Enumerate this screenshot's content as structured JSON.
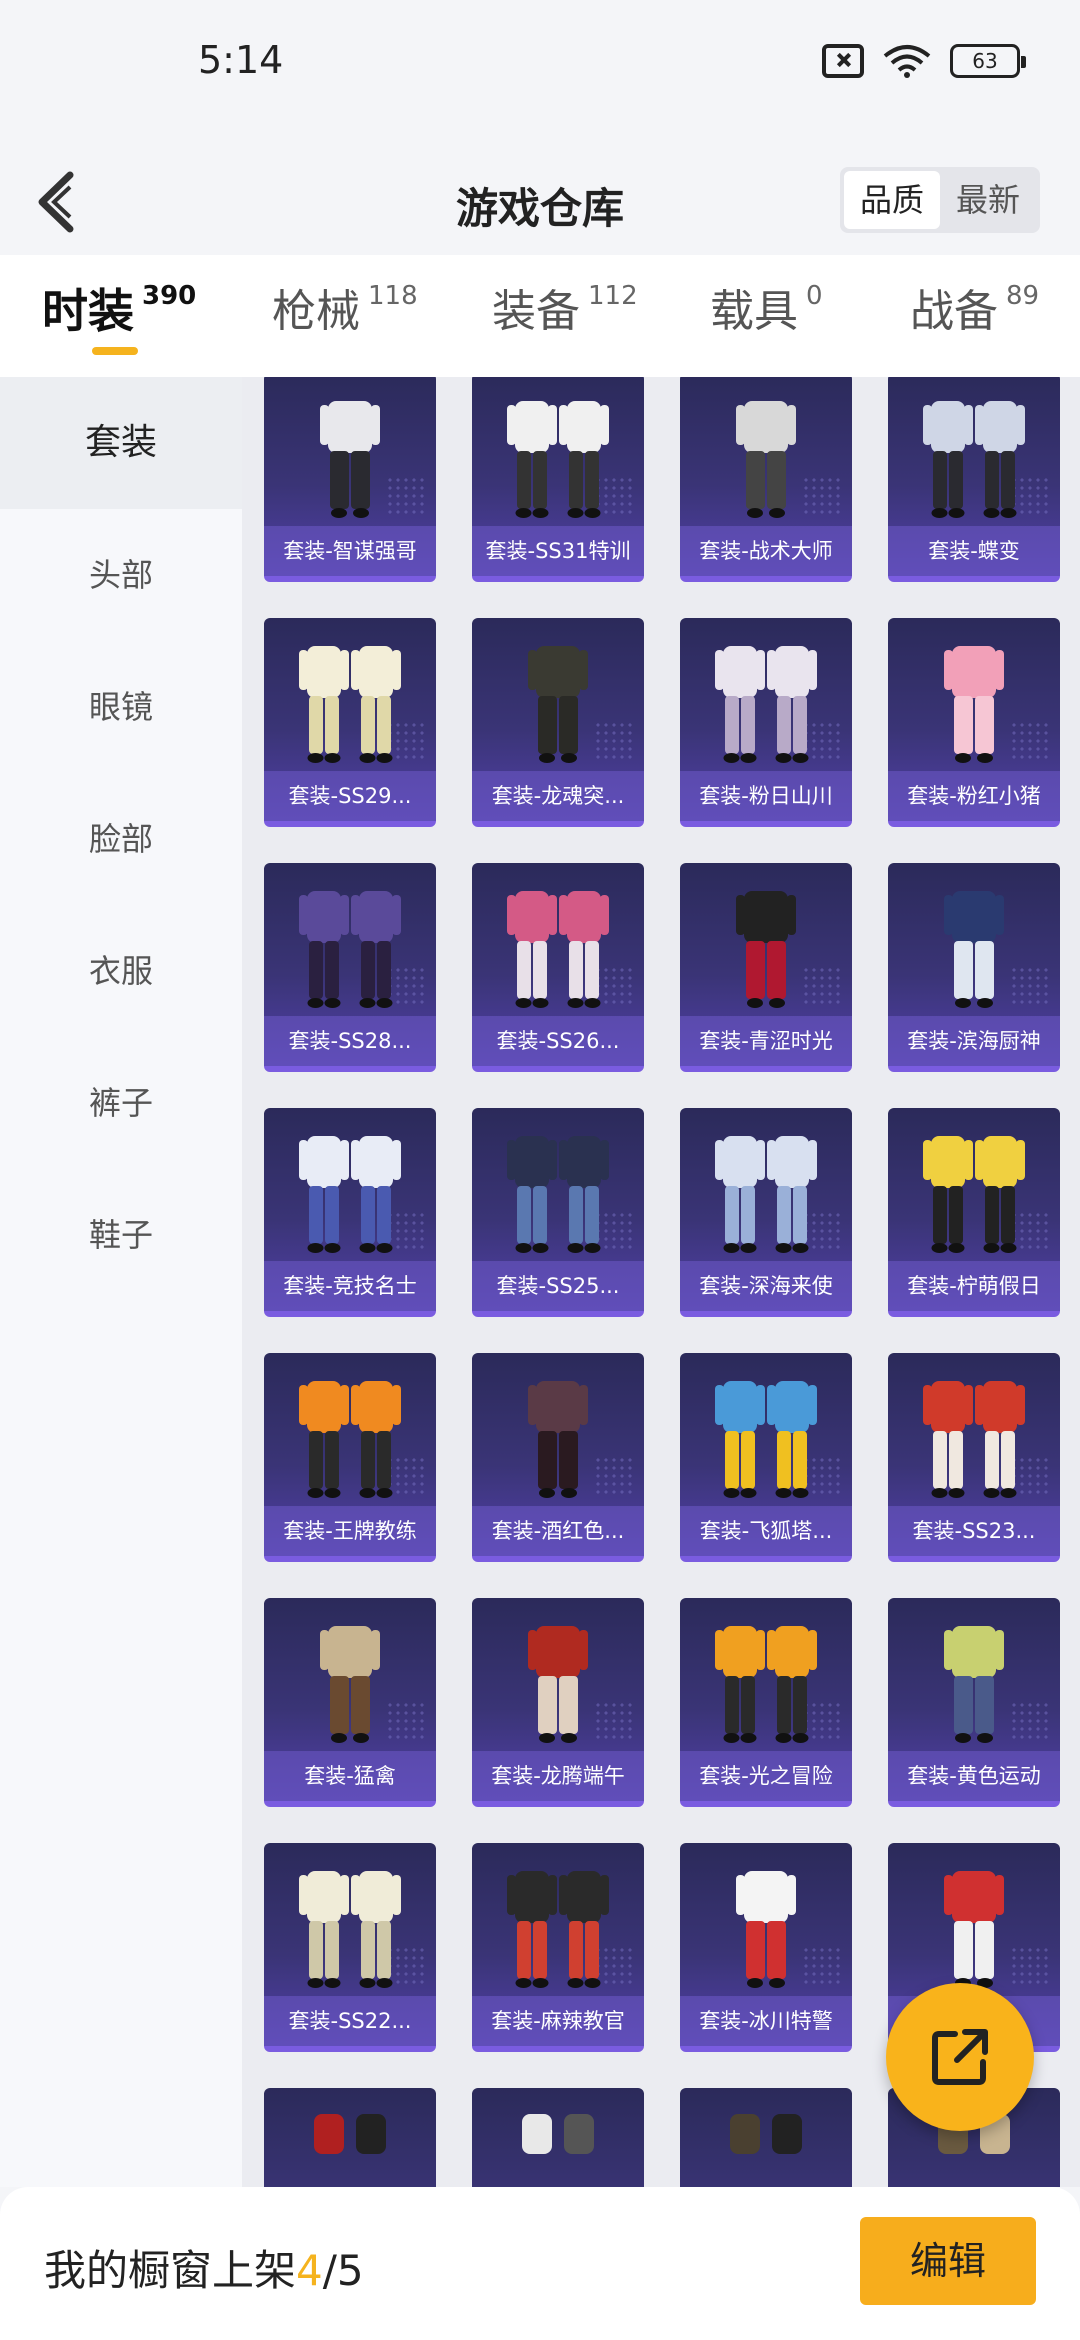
{
  "status_bar": {
    "time": "5:14",
    "battery": "63"
  },
  "header": {
    "title": "游戏仓库",
    "sort_options": [
      "品质",
      "最新"
    ]
  },
  "tabs": [
    {
      "label": "时装",
      "count": "390"
    },
    {
      "label": "枪械",
      "count": "118"
    },
    {
      "label": "装备",
      "count": "112"
    },
    {
      "label": "载具",
      "count": "0"
    },
    {
      "label": "战备",
      "count": "89"
    }
  ],
  "sidebar": [
    "套装",
    "头部",
    "眼镜",
    "脸部",
    "衣服",
    "裤子",
    "鞋子"
  ],
  "items": [
    "套装-智谋强哥",
    "套装-SS31特训",
    "套装-战术大师",
    "套装-蝶变",
    "套装-SS29...",
    "套装-龙魂突...",
    "套装-粉日山川",
    "套装-粉红小猪",
    "套装-SS28...",
    "套装-SS26...",
    "套装-青涩时光",
    "套装-滨海厨神",
    "套装-竞技名士",
    "套装-SS25...",
    "套装-深海来使",
    "套装-柠萌假日",
    "套装-王牌教练",
    "套装-酒红色...",
    "套装-飞狐塔...",
    "套装-SS23...",
    "套装-猛禽",
    "套装-龙腾端午",
    "套装-光之冒险",
    "套装-黄色运动",
    "套装-SS22...",
    "套装-麻辣教官",
    "套装-冰川特警",
    "套装-"
  ],
  "bottom_bar": {
    "label": "我的橱窗上架",
    "count_current": "4",
    "count_sep": "/",
    "count_total": "5",
    "edit_label": "编辑"
  },
  "colors": {
    "accent": "#f5b31e",
    "card_bg": "#3a3476"
  },
  "icons": {
    "back": "back-arrow-icon",
    "share": "share-export-icon"
  }
}
